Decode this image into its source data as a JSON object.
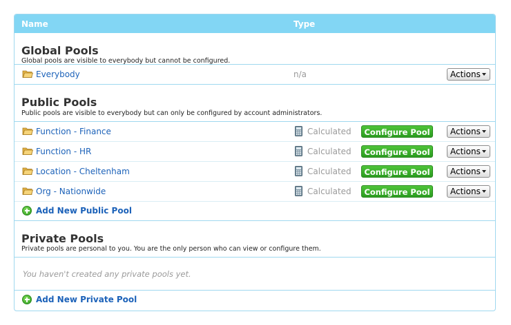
{
  "header": {
    "col_name": "Name",
    "col_type": "Type"
  },
  "global": {
    "title": "Global Pools",
    "desc": "Global pools are visible to everybody but cannot be configured.",
    "rows": [
      {
        "name": "Everybody",
        "type": "n/a",
        "actions": "Actions"
      }
    ]
  },
  "public": {
    "title": "Public Pools",
    "desc": "Public pools are visible to everybody but can only be configured by account administrators.",
    "rows": [
      {
        "name": "Function - Finance",
        "type": "Calculated",
        "configure": "Configure Pool",
        "actions": "Actions"
      },
      {
        "name": "Function - HR",
        "type": "Calculated",
        "configure": "Configure Pool",
        "actions": "Actions"
      },
      {
        "name": "Location - Cheltenham",
        "type": "Calculated",
        "configure": "Configure Pool",
        "actions": "Actions"
      },
      {
        "name": "Org - Nationwide",
        "type": "Calculated",
        "configure": "Configure Pool",
        "actions": "Actions"
      }
    ],
    "add_label": "Add New Public Pool"
  },
  "private": {
    "title": "Private Pools",
    "desc": "Private pools are personal to you. You are the only person who can view or configure them.",
    "empty_text": "You haven't created any private pools yet.",
    "add_label": "Add New Private Pool"
  },
  "icons": {
    "folder": "folder-icon",
    "calculator": "calculator-icon",
    "add": "plus-circle-icon",
    "caret": "caret-down-icon"
  },
  "colors": {
    "header_bg": "#82d6f4",
    "link": "#1c62b9",
    "configure_btn": "#3aae2a"
  }
}
